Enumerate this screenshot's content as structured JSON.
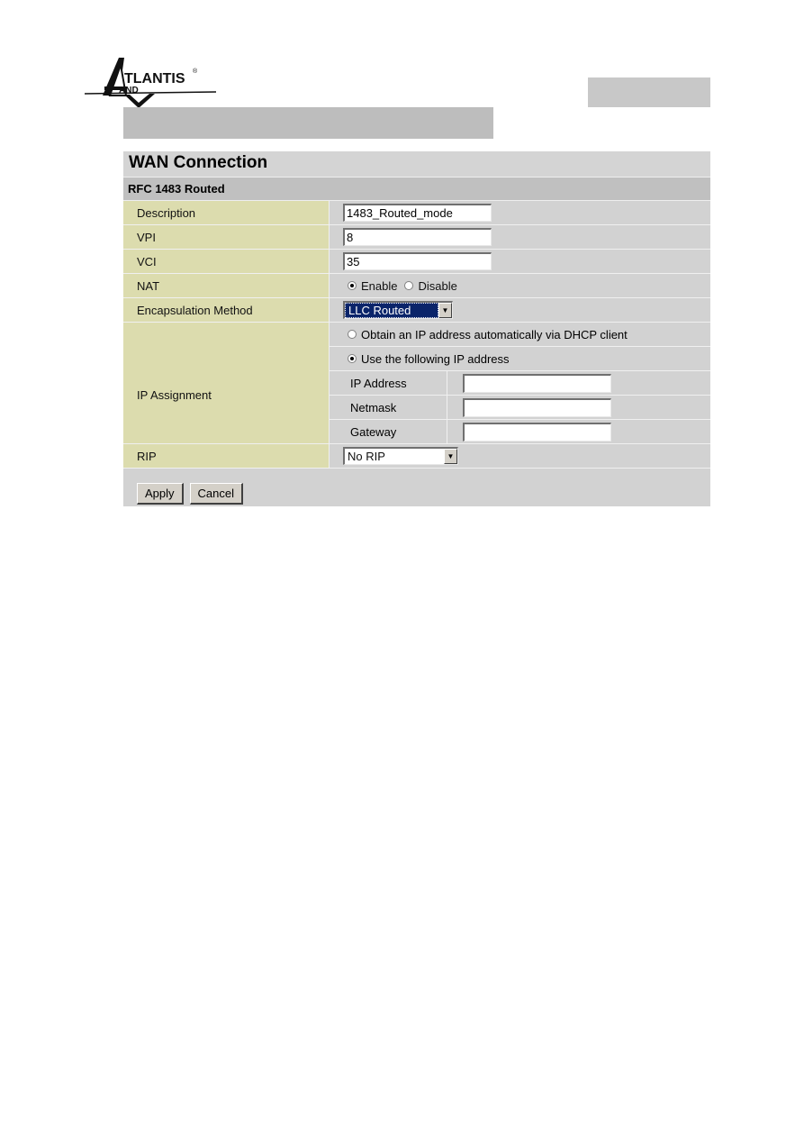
{
  "logo": {
    "brand_top": "TLANTIS",
    "brand_bottom": "AND",
    "registered": "®"
  },
  "panel": {
    "title": "WAN Connection",
    "subtitle": "RFC 1483 Routed",
    "fields": {
      "description": {
        "label": "Description",
        "value": "1483_Routed_mode"
      },
      "vpi": {
        "label": "VPI",
        "value": "8"
      },
      "vci": {
        "label": "VCI",
        "value": "35"
      },
      "nat": {
        "label": "NAT",
        "options": [
          {
            "label": "Enable",
            "checked": true
          },
          {
            "label": "Disable",
            "checked": false
          }
        ]
      },
      "encapsulation": {
        "label": "Encapsulation Method",
        "selected": "LLC Routed"
      },
      "ip_assignment": {
        "label": "IP Assignment",
        "dhcp_option": {
          "label": "Obtain an IP address automatically via DHCP client",
          "checked": false
        },
        "static_option": {
          "label": "Use the following IP address",
          "checked": true
        },
        "ip_address": {
          "label": "IP Address",
          "value": ""
        },
        "netmask": {
          "label": "Netmask",
          "value": ""
        },
        "gateway": {
          "label": "Gateway",
          "value": ""
        }
      },
      "rip": {
        "label": "RIP",
        "selected": "No RIP"
      }
    },
    "buttons": {
      "apply": "Apply",
      "cancel": "Cancel"
    }
  },
  "icons": {
    "dropdown_arrow": "▼"
  }
}
